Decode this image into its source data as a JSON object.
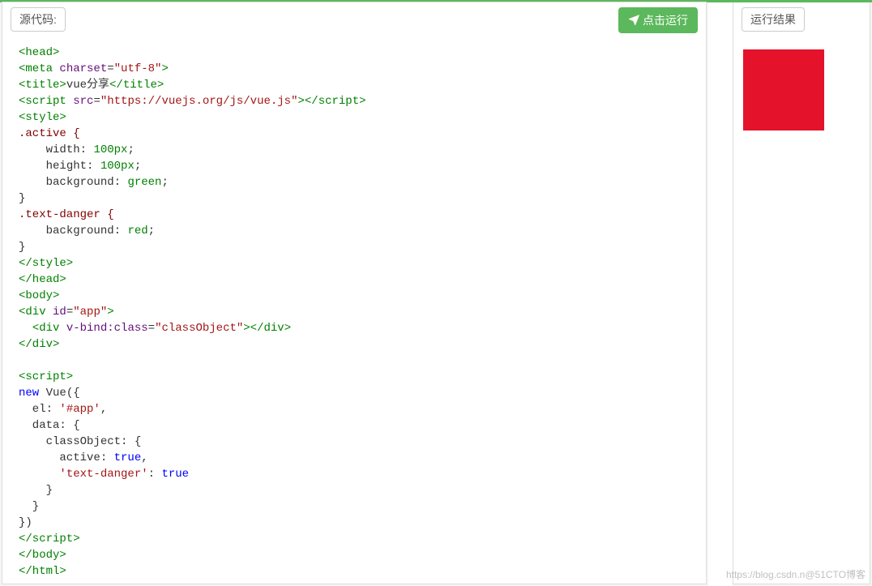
{
  "header": {
    "source_label": "源代码:",
    "run_button_label": "点击运行",
    "result_label": "运行结果"
  },
  "result": {
    "square_color": "#e4122b",
    "square_width": 100,
    "square_height": 100
  },
  "watermark": "https://blog.csdn.n@51CTO博客",
  "code": {
    "lines": [
      {
        "type": "tag-open",
        "tag": "head"
      },
      {
        "type": "meta",
        "tag": "meta",
        "attr": "charset",
        "value": "utf-8"
      },
      {
        "type": "title",
        "tag": "title",
        "text": "vue分享"
      },
      {
        "type": "script-src",
        "tag": "script",
        "attr": "src",
        "value": "https://vuejs.org/js/vue.js"
      },
      {
        "type": "tag-open",
        "tag": "style"
      },
      {
        "type": "css-sel",
        "text": ".active {"
      },
      {
        "type": "css-rule",
        "prop": "width",
        "val": "100px",
        "indent": 4
      },
      {
        "type": "css-rule",
        "prop": "height",
        "val": "100px",
        "indent": 4
      },
      {
        "type": "css-rule",
        "prop": "background",
        "val": "green",
        "indent": 4
      },
      {
        "type": "css-close",
        "text": "}"
      },
      {
        "type": "css-sel",
        "text": ".text-danger {"
      },
      {
        "type": "css-rule",
        "prop": "background",
        "val": "red",
        "indent": 4
      },
      {
        "type": "css-close",
        "text": "}"
      },
      {
        "type": "tag-close",
        "tag": "style"
      },
      {
        "type": "tag-close",
        "tag": "head"
      },
      {
        "type": "tag-open",
        "tag": "body"
      },
      {
        "type": "div-id",
        "tag": "div",
        "attr": "id",
        "value": "app"
      },
      {
        "type": "div-bind",
        "tag": "div",
        "attr": "v-bind:class",
        "value": "classObject",
        "indent": 2
      },
      {
        "type": "tag-close",
        "tag": "div"
      },
      {
        "type": "blank"
      },
      {
        "type": "tag-open",
        "tag": "script"
      },
      {
        "type": "js",
        "parts": [
          {
            "c": "kw",
            "t": "new"
          },
          {
            "c": "plain",
            "t": " Vue({"
          }
        ]
      },
      {
        "type": "js",
        "parts": [
          {
            "c": "plain",
            "t": "  el: "
          },
          {
            "c": "str",
            "t": "'#app'"
          },
          {
            "c": "plain",
            "t": ","
          }
        ]
      },
      {
        "type": "js",
        "parts": [
          {
            "c": "plain",
            "t": "  data: {"
          }
        ]
      },
      {
        "type": "js",
        "parts": [
          {
            "c": "plain",
            "t": "    classObject: {"
          }
        ]
      },
      {
        "type": "js",
        "parts": [
          {
            "c": "plain",
            "t": "      active: "
          },
          {
            "c": "kw",
            "t": "true"
          },
          {
            "c": "plain",
            "t": ","
          }
        ]
      },
      {
        "type": "js",
        "parts": [
          {
            "c": "plain",
            "t": "      "
          },
          {
            "c": "str",
            "t": "'text-danger'"
          },
          {
            "c": "plain",
            "t": ": "
          },
          {
            "c": "kw",
            "t": "true"
          }
        ]
      },
      {
        "type": "js",
        "parts": [
          {
            "c": "plain",
            "t": "    }"
          }
        ]
      },
      {
        "type": "js",
        "parts": [
          {
            "c": "plain",
            "t": "  }"
          }
        ]
      },
      {
        "type": "js",
        "parts": [
          {
            "c": "plain",
            "t": "})"
          }
        ]
      },
      {
        "type": "tag-close",
        "tag": "script"
      },
      {
        "type": "tag-close",
        "tag": "body"
      },
      {
        "type": "tag-close",
        "tag": "html"
      }
    ]
  }
}
